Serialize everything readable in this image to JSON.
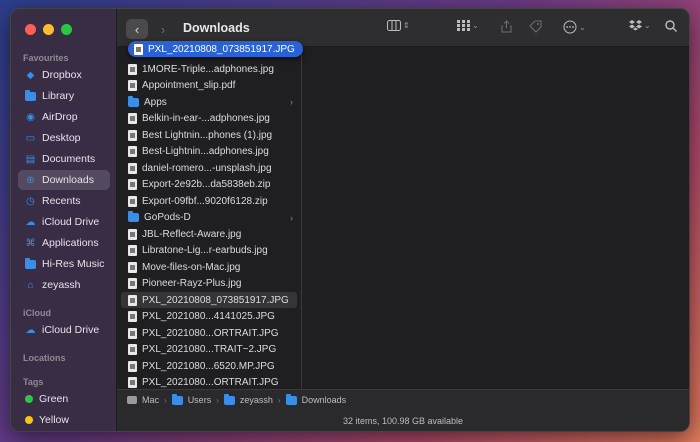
{
  "window": {
    "title": "Downloads"
  },
  "sidebar": {
    "favourites_title": "Favourites",
    "favourites": [
      {
        "label": "Dropbox",
        "icon": "dropbox-icon"
      },
      {
        "label": "Library",
        "icon": "folder-icon"
      },
      {
        "label": "AirDrop",
        "icon": "airdrop-icon"
      },
      {
        "label": "Desktop",
        "icon": "desktop-icon"
      },
      {
        "label": "Documents",
        "icon": "document-icon"
      },
      {
        "label": "Downloads",
        "icon": "download-icon",
        "active": true
      },
      {
        "label": "Recents",
        "icon": "clock-icon"
      },
      {
        "label": "iCloud Drive",
        "icon": "cloud-icon"
      },
      {
        "label": "Applications",
        "icon": "applications-icon"
      },
      {
        "label": "Hi-Res Music",
        "icon": "folder-icon"
      },
      {
        "label": "zeyassh",
        "icon": "home-icon"
      }
    ],
    "icloud_title": "iCloud",
    "icloud": [
      {
        "label": "iCloud Drive",
        "icon": "cloud-icon"
      }
    ],
    "locations_title": "Locations",
    "tags_title": "Tags",
    "tags": [
      {
        "label": "Green",
        "color": "#30c24a"
      },
      {
        "label": "Yellow",
        "color": "#f5c518"
      }
    ]
  },
  "drag_item": {
    "label": "PXL_20210808_073851917.JPG"
  },
  "files": [
    {
      "name": "1MORE-Triple...adphones.jpg",
      "type": "file"
    },
    {
      "name": "Appointment_slip.pdf",
      "type": "file"
    },
    {
      "name": "Apps",
      "type": "folder"
    },
    {
      "name": "Belkin-in-ear-...adphones.jpg",
      "type": "file"
    },
    {
      "name": "Best Lightnin...phones (1).jpg",
      "type": "file"
    },
    {
      "name": "Best-Lightnin...adphones.jpg",
      "type": "file"
    },
    {
      "name": "daniel-romero...-unsplash.jpg",
      "type": "file"
    },
    {
      "name": "Export-2e92b...da5838eb.zip",
      "type": "file"
    },
    {
      "name": "Export-09fbf...9020f6128.zip",
      "type": "file"
    },
    {
      "name": "GoPods-D",
      "type": "folder"
    },
    {
      "name": "JBL-Reflect-Aware.jpg",
      "type": "file"
    },
    {
      "name": "Libratone-Lig...r-earbuds.jpg",
      "type": "file"
    },
    {
      "name": "Move-files-on-Mac.jpg",
      "type": "file"
    },
    {
      "name": "Pioneer-Rayz-Plus.jpg",
      "type": "file"
    },
    {
      "name": "PXL_20210808_073851917.JPG",
      "type": "file",
      "highlight": true
    },
    {
      "name": "PXL_2021080...4141025.JPG",
      "type": "file"
    },
    {
      "name": "PXL_2021080...ORTRAIT.JPG",
      "type": "file"
    },
    {
      "name": "PXL_2021080...TRAIT~2.JPG",
      "type": "file"
    },
    {
      "name": "PXL_2021080...6520.MP.JPG",
      "type": "file"
    },
    {
      "name": "PXL_2021080...ORTRAIT.JPG",
      "type": "file"
    }
  ],
  "pathbar": [
    "Mac",
    "Users",
    "zeyassh",
    "Downloads"
  ],
  "status": "32 items, 100.98 GB available"
}
